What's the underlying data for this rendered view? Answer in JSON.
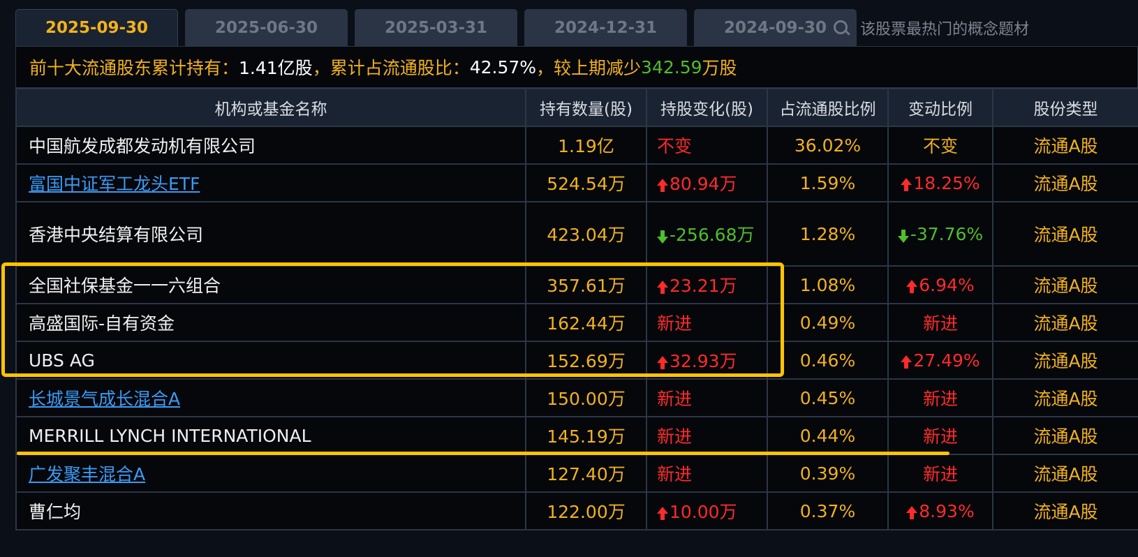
{
  "tabs": [
    "2025-09-30",
    "2025-06-30",
    "2025-03-31",
    "2024-12-31",
    "2024-09-30"
  ],
  "search": {
    "placeholder": "该股票最热门的概念题材"
  },
  "summary": {
    "prefix": "前十大流通股东累计持有：",
    "holding": "1.41亿股",
    "sep1": "，累计占流通股比：",
    "ratio": "42.57%",
    "sep2": "，较上期减少",
    "change": "342.59",
    "unit": "万股"
  },
  "headers": [
    "机构或基金名称",
    "持有数量(股)",
    "持股变化(股)",
    "占流通股比例",
    "变动比例",
    "股份类型"
  ],
  "rows": [
    {
      "name": "中国航发成都发动机有限公司",
      "link": false,
      "qty": "1.19亿",
      "change": "不变",
      "change_dir": "none",
      "ratio": "36.02%",
      "pct": "不变",
      "pct_dir": "none",
      "type": "流通A股"
    },
    {
      "name": "富国中证军工龙头ETF",
      "link": true,
      "qty": "524.54万",
      "change": "80.94万",
      "change_dir": "up",
      "ratio": "1.59%",
      "pct": "18.25%",
      "pct_dir": "up",
      "type": "流通A股"
    },
    {
      "name": "香港中央结算有限公司",
      "link": false,
      "qty": "423.04万",
      "change": "-256.68万",
      "change_dir": "down",
      "ratio": "1.28%",
      "pct": "-37.76%",
      "pct_dir": "down",
      "type": "流通A股"
    },
    {
      "name": "全国社保基金一一六组合",
      "link": false,
      "qty": "357.61万",
      "change": "23.21万",
      "change_dir": "up",
      "ratio": "1.08%",
      "pct": "6.94%",
      "pct_dir": "up",
      "type": "流通A股"
    },
    {
      "name": "高盛国际-自有资金",
      "link": false,
      "qty": "162.44万",
      "change": "新进",
      "change_dir": "new",
      "ratio": "0.49%",
      "pct": "新进",
      "pct_dir": "new",
      "type": "流通A股"
    },
    {
      "name": "UBS AG",
      "link": false,
      "qty": "152.69万",
      "change": "32.93万",
      "change_dir": "up",
      "ratio": "0.46%",
      "pct": "27.49%",
      "pct_dir": "up",
      "type": "流通A股"
    },
    {
      "name": "长城景气成长混合A",
      "link": true,
      "qty": "150.00万",
      "change": "新进",
      "change_dir": "new",
      "ratio": "0.45%",
      "pct": "新进",
      "pct_dir": "new",
      "type": "流通A股"
    },
    {
      "name": "MERRILL LYNCH INTERNATIONAL",
      "link": false,
      "qty": "145.19万",
      "change": "新进",
      "change_dir": "new",
      "ratio": "0.44%",
      "pct": "新进",
      "pct_dir": "new",
      "type": "流通A股"
    },
    {
      "name": "广发聚丰混合A",
      "link": true,
      "qty": "127.40万",
      "change": "新进",
      "change_dir": "new",
      "ratio": "0.39%",
      "pct": "新进",
      "pct_dir": "new",
      "type": "流通A股"
    },
    {
      "name": "曹仁均",
      "link": false,
      "qty": "122.00万",
      "change": "10.00万",
      "change_dir": "up",
      "ratio": "0.37%",
      "pct": "8.93%",
      "pct_dir": "up",
      "type": "流通A股"
    }
  ],
  "colors": {
    "accent": "#f2b21a",
    "up": "#ff2a2a",
    "down": "#4fbf2a",
    "link": "#3a9bf5",
    "highlight": "#ffc400"
  }
}
